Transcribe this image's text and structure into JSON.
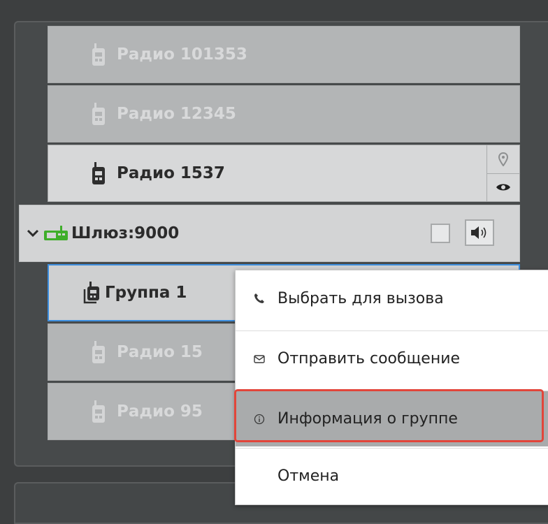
{
  "tree": {
    "radios_top": [
      {
        "label": "Радио 101353",
        "icon": "radio-icon",
        "active": false
      },
      {
        "label": "Радио 12345",
        "icon": "radio-icon",
        "active": false
      },
      {
        "label": "Радио 1537",
        "icon": "radio-icon",
        "active": true
      }
    ],
    "gateway": {
      "label": "Шлюз:9000",
      "icon": "gateway-icon",
      "accent": "#3fae2a"
    },
    "group": {
      "label": "Группа 1",
      "icon": "group-radio-icon"
    },
    "radios_bottom": [
      {
        "label": "Радио 15",
        "icon": "radio-icon"
      },
      {
        "label": "Радио 95",
        "icon": "radio-icon"
      }
    ]
  },
  "context_menu": {
    "items": [
      {
        "label": "Выбрать для вызова",
        "icon": "phone-icon"
      },
      {
        "label": "Отправить сообщение",
        "icon": "envelope-icon"
      },
      {
        "label": "Информация о группе",
        "icon": "info-icon",
        "highlighted": true
      },
      {
        "label": "Отмена",
        "icon": ""
      }
    ],
    "highlight_color": "#e2453a"
  },
  "colors": {
    "selection_border": "#3d8fe0",
    "gateway_icon": "#3fae2a"
  }
}
